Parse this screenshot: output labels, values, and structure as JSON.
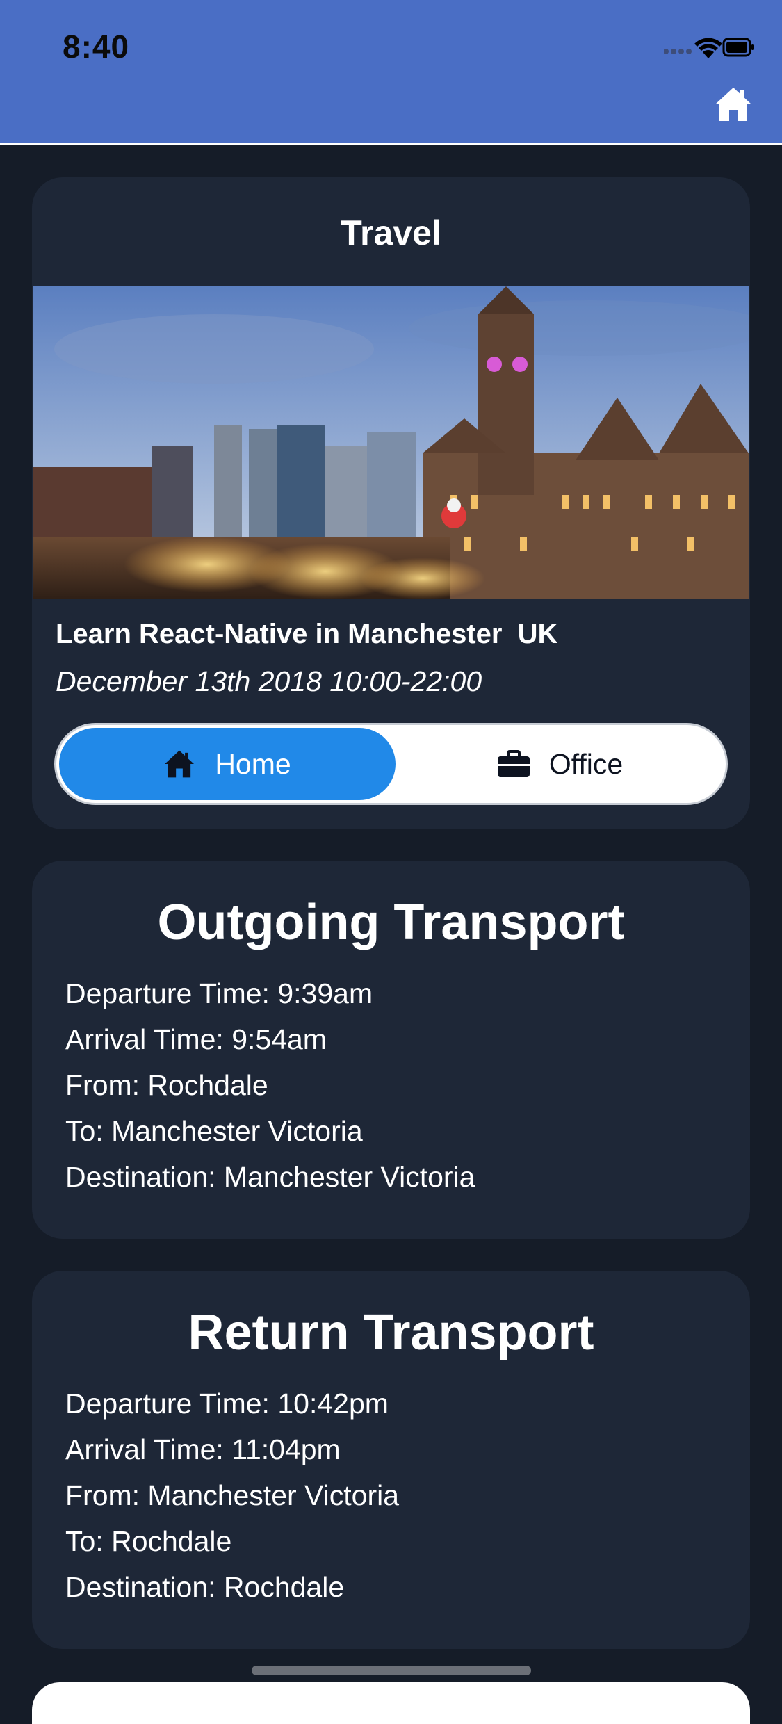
{
  "status_bar": {
    "time": "8:40"
  },
  "header": {
    "home_icon": "home-icon",
    "accent_color": "#4a6ec5"
  },
  "travel": {
    "title": "Travel",
    "photo_icon": "manchester-town-hall-photo",
    "event_title": "Learn React-Native in Manchester  UK",
    "event_date": "December 13th 2018 10:00-22:00",
    "toggle": {
      "selected": "Home",
      "options": [
        {
          "label": "Home",
          "icon": "home-icon"
        },
        {
          "label": "Office",
          "icon": "briefcase-icon"
        }
      ],
      "selected_color": "#2189e8"
    }
  },
  "outgoing": {
    "title": "Outgoing Transport",
    "lines": [
      "Departure Time: 9:39am",
      "Arrival Time: 9:54am",
      "From: Rochdale",
      "To: Manchester Victoria",
      "Destination: Manchester Victoria"
    ]
  },
  "return": {
    "title": "Return Transport",
    "lines": [
      "Departure Time: 10:42pm",
      "Arrival Time: 11:04pm",
      "From: Manchester Victoria",
      "To: Rochdale",
      "Destination: Rochdale"
    ]
  }
}
